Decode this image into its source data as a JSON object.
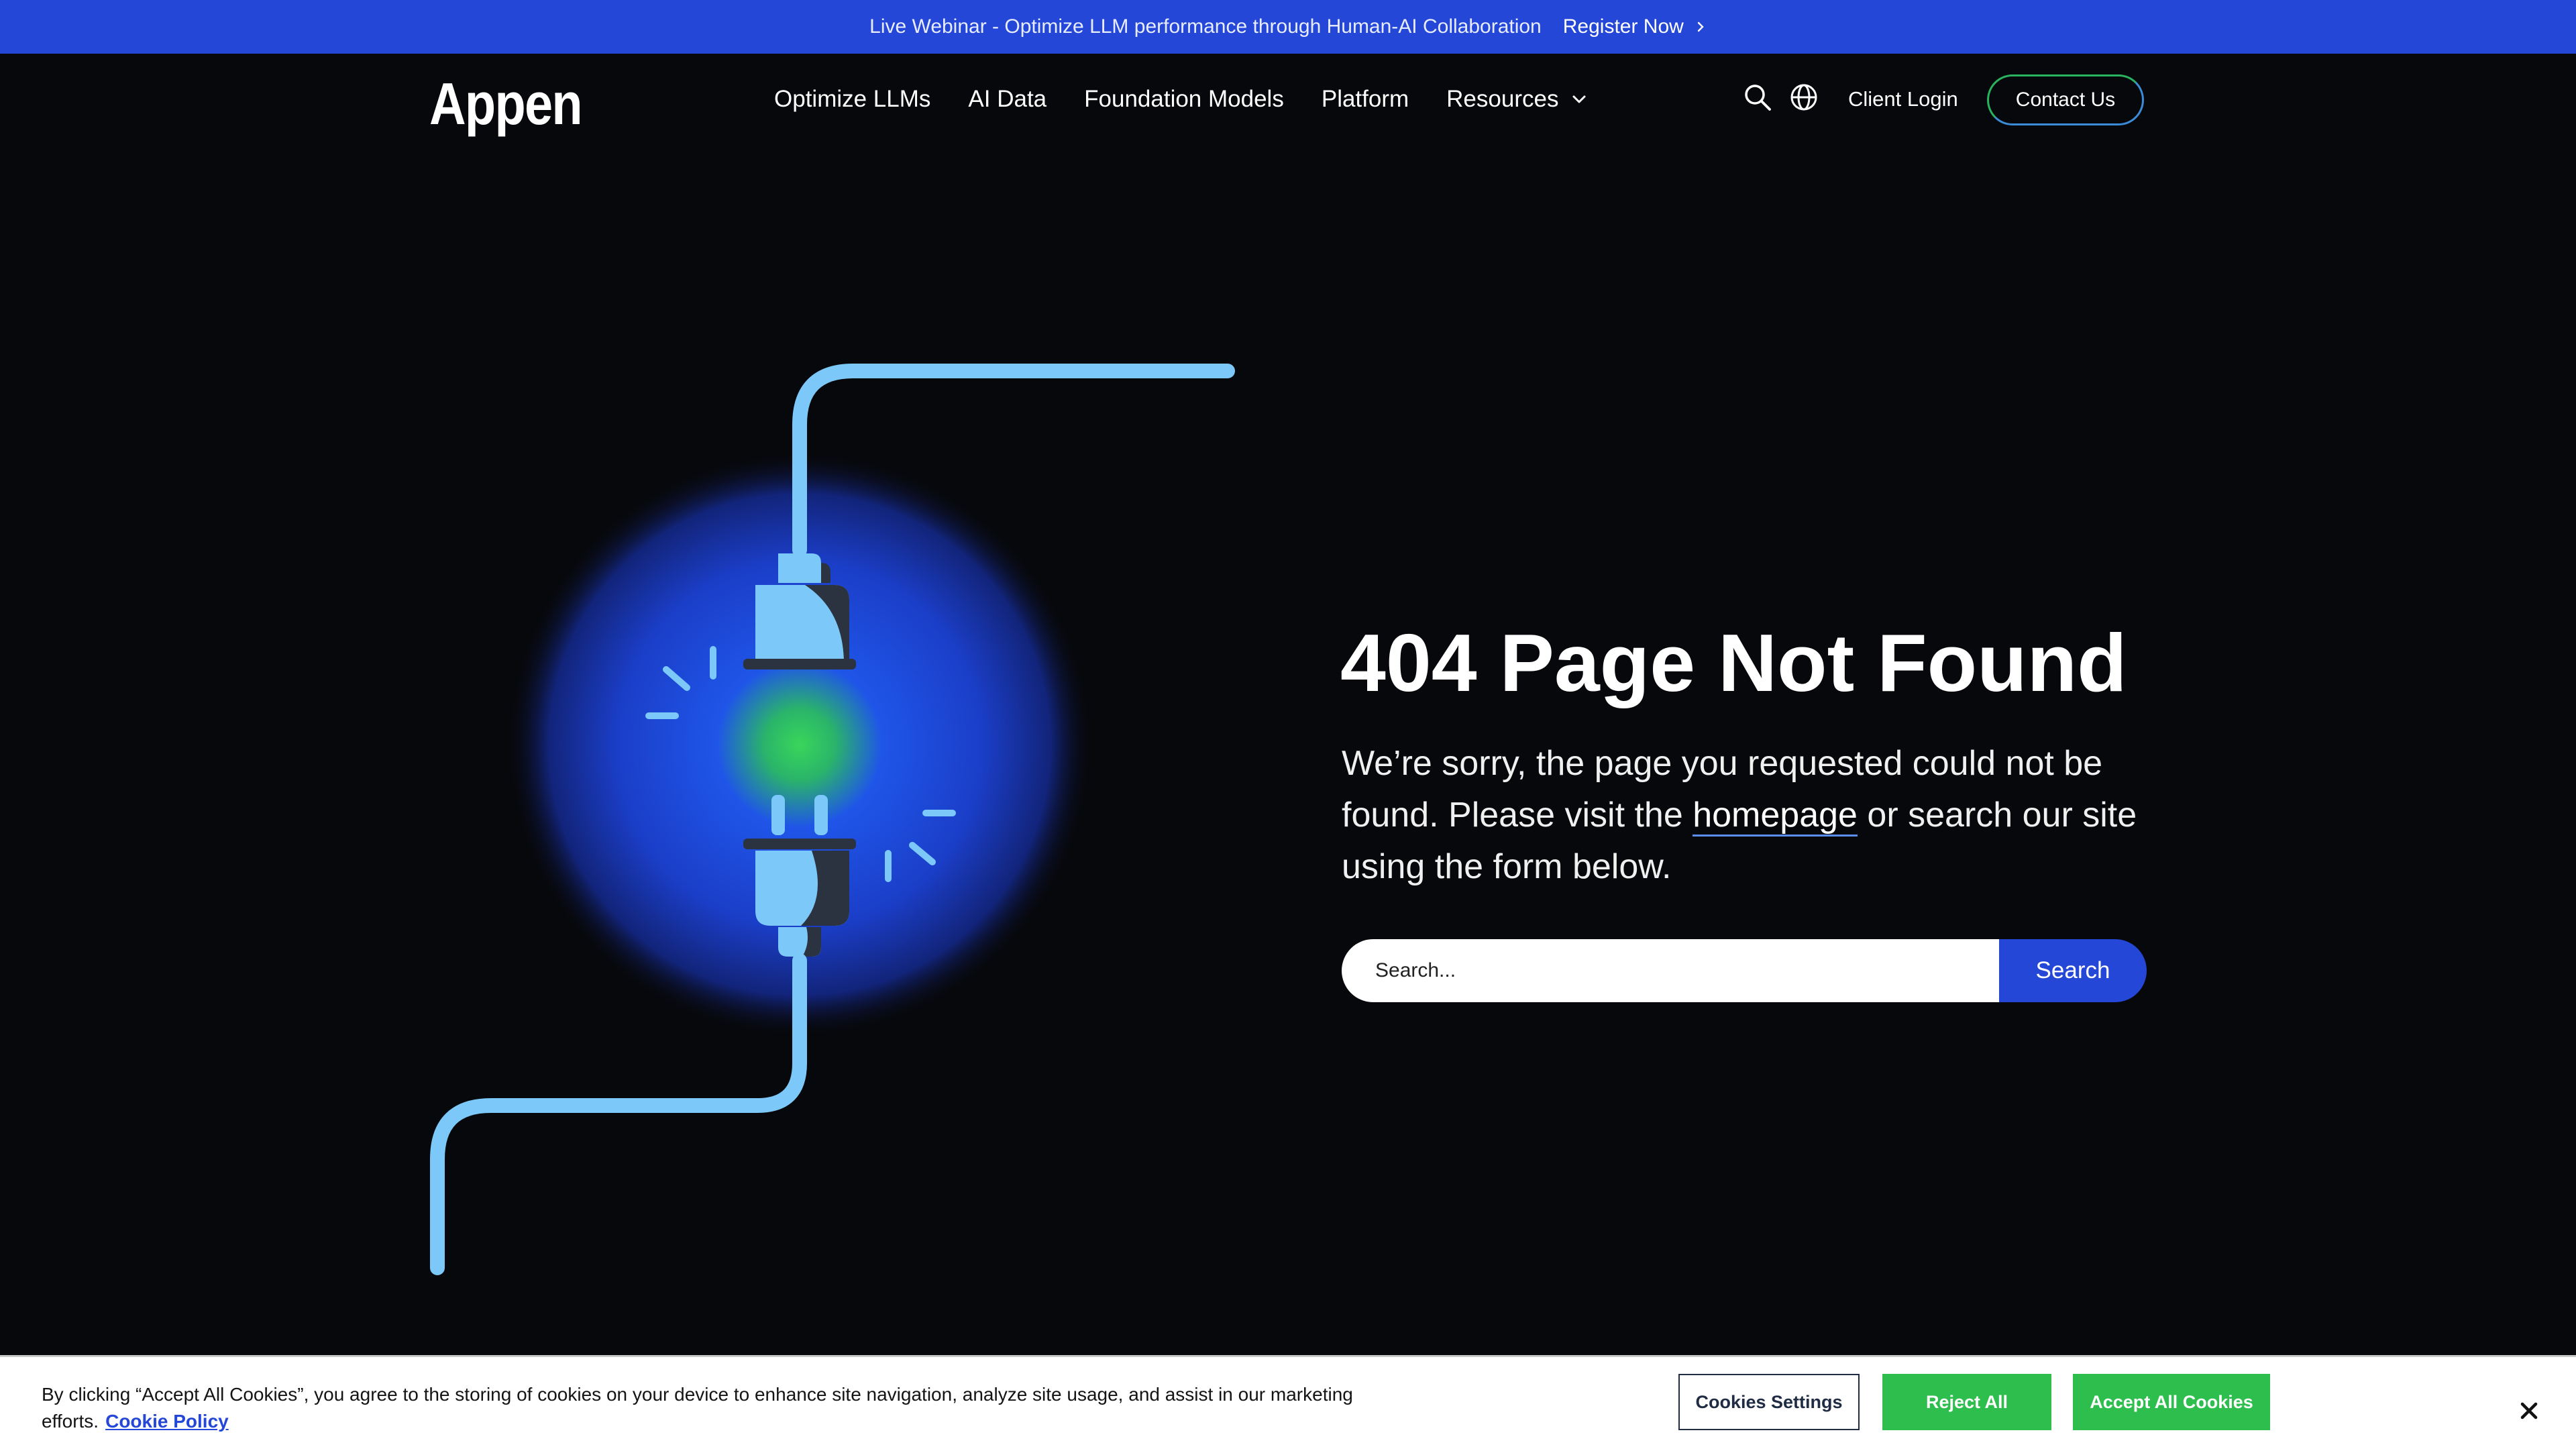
{
  "banner": {
    "text": "Live Webinar - Optimize LLM performance through Human-AI Collaboration",
    "cta": "Register Now"
  },
  "nav": {
    "logo": "Appen",
    "items": [
      "Optimize LLMs",
      "AI Data",
      "Foundation Models",
      "Platform"
    ],
    "resources": "Resources",
    "client_login": "Client Login",
    "contact": "Contact Us"
  },
  "main": {
    "title": "404 Page Not Found",
    "desc_before": "We’re sorry, the page you requested could not be found. Please visit the ",
    "desc_link": "homepage",
    "desc_after": " or search our site using the form below.",
    "search_placeholder": "Search...",
    "search_button": "Search"
  },
  "cookie": {
    "text": "By clicking “Accept All Cookies”, you agree to the storing of cookies on your device to enhance site navigation, analyze site usage, and assist in our marketing efforts.",
    "policy_link": "Cookie Policy",
    "settings": "Cookies Settings",
    "reject": "Reject All",
    "accept": "Accept All Cookies"
  },
  "colors": {
    "banner_bg": "#2447d8",
    "page_bg": "#07080b",
    "plug": "#7cc8f8",
    "accent_green": "#2dbe4e"
  },
  "icons": [
    "chevron-right-icon",
    "chevron-down-icon",
    "search-icon",
    "globe-icon",
    "close-icon",
    "unplugged-cable-illustration"
  ]
}
